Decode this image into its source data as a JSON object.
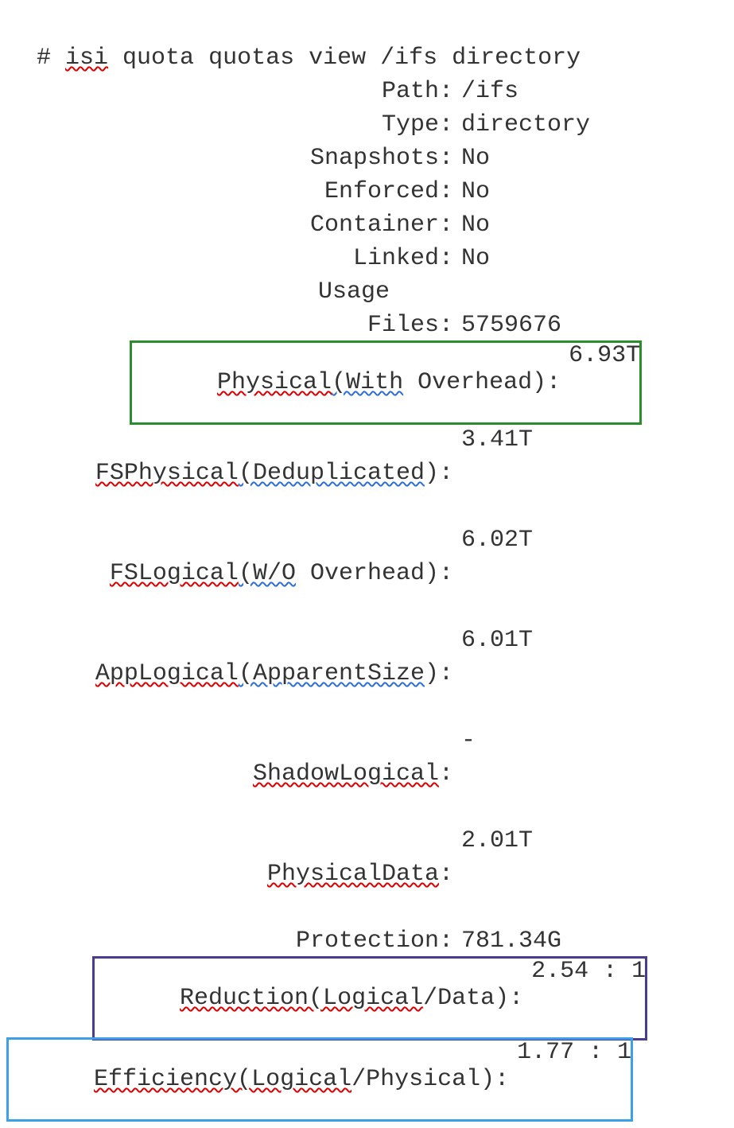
{
  "command": {
    "prompt": "# ",
    "isi": "isi",
    "rest": " quota quotas view /ifs directory"
  },
  "fields": {
    "path": {
      "label": "Path:",
      "value": "/ifs"
    },
    "type": {
      "label": "Type:",
      "value": "directory"
    },
    "snapshots": {
      "label": "Snapshots:",
      "value": "No"
    },
    "enforced": {
      "label": "Enforced:",
      "value": "No"
    },
    "container": {
      "label": "Container:",
      "value": "No"
    },
    "linked": {
      "label": "Linked:",
      "value": "No"
    },
    "usage_header": {
      "label": "Usage",
      "value": ""
    },
    "files": {
      "label": "Files:",
      "value": "5759676"
    },
    "physical": {
      "label_physical": "Physical",
      "label_with": "(With",
      "label_overhead": " Overhead):",
      "value": "6.93T"
    },
    "fsphysical": {
      "label_fsphysical": "FSPhysical",
      "label_dedup": "(Deduplicated",
      "label_paren": "):",
      "value": "3.41T"
    },
    "fslogical": {
      "label_fslogical": "FSLogical",
      "label_wo": "(W/O",
      "label_overhead": " Overhead):",
      "value": "6.02T"
    },
    "applogical": {
      "label_applogical": "AppLogical",
      "label_apparent": "(ApparentSize",
      "label_paren": "):",
      "value": "6.01T"
    },
    "shadowlogical": {
      "label_shadow": "ShadowLogical",
      "label_colon": ":",
      "value": "-"
    },
    "physicaldata": {
      "label_physdata": "PhysicalData",
      "label_colon": ":",
      "value": "2.01T"
    },
    "protection": {
      "label": "Protection:",
      "value": "781.34G"
    },
    "reduction": {
      "label_reduction": "Reduction(Logical",
      "label_data": "/Data):",
      "value": "2.54 : 1"
    },
    "efficiency": {
      "label_efficiency": "Efficiency(Logical",
      "label_physical": "/Physical):",
      "value": "1.77 : 1"
    }
  }
}
